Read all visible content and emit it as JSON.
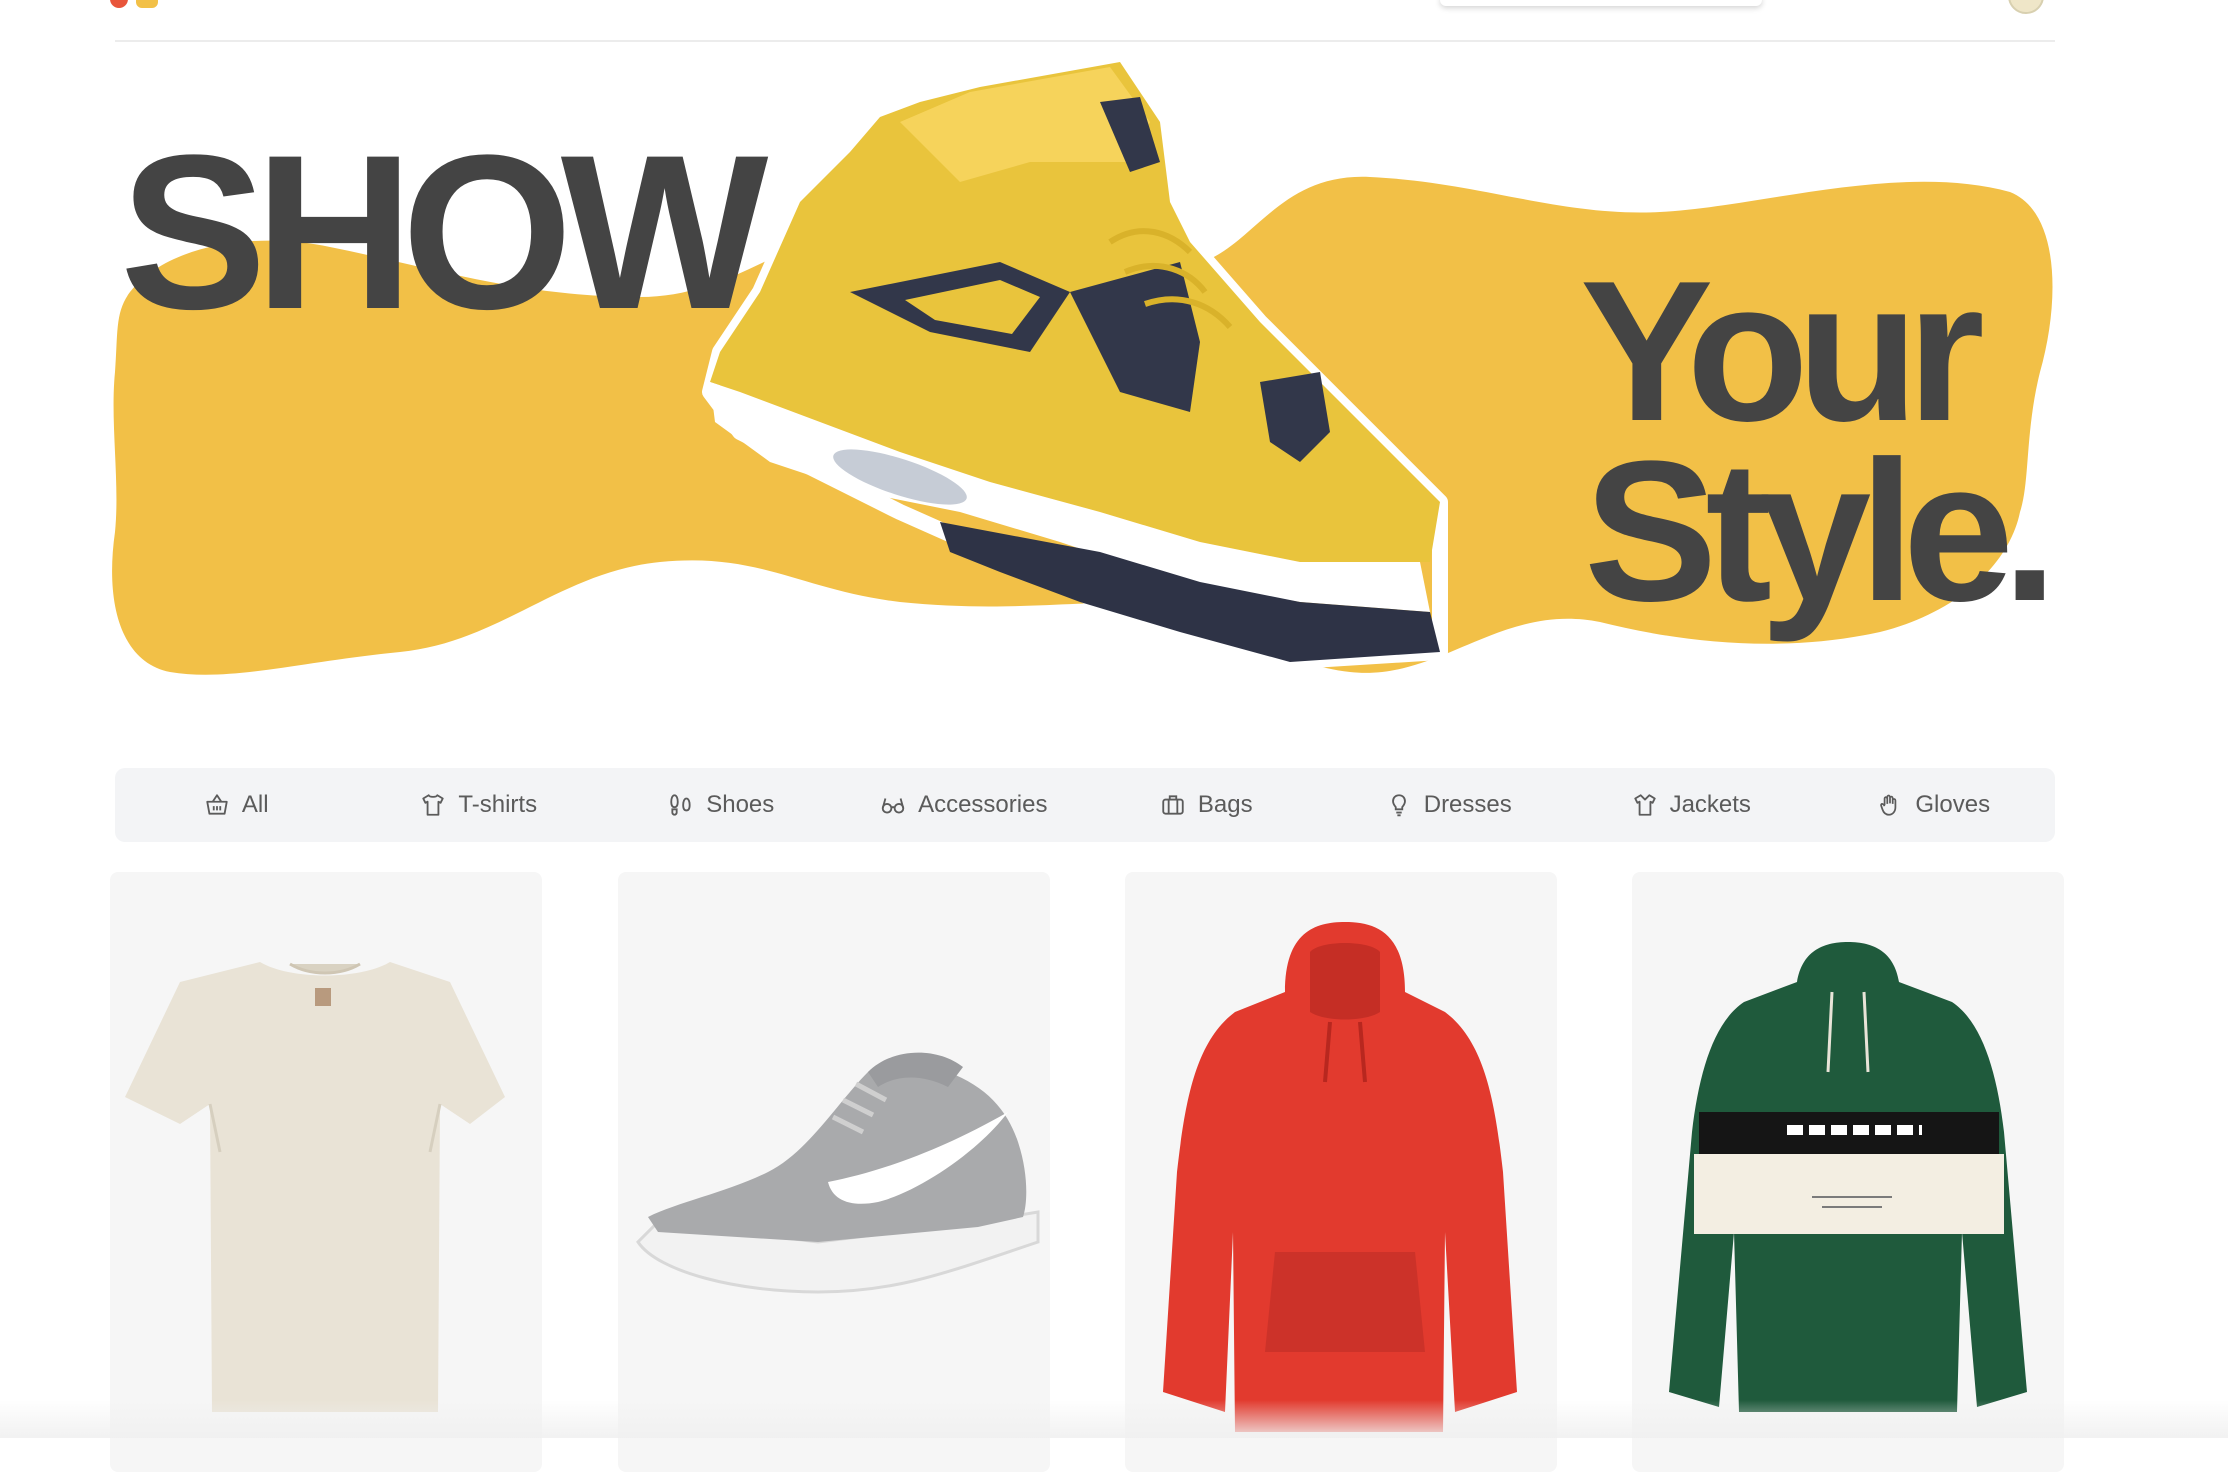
{
  "brand": {
    "colors": {
      "accent": "#f2c047",
      "text": "#444444",
      "logo_red": "#e8553b"
    }
  },
  "header": {
    "search_icon": "search-box",
    "avatar": "user-avatar"
  },
  "hero": {
    "line1": "SHOW",
    "line2": "Your",
    "line3": "Style.",
    "image": "yellow-sneaker"
  },
  "categories": [
    {
      "label": "All",
      "icon": "basket-icon"
    },
    {
      "label": "T-shirts",
      "icon": "tshirt-icon"
    },
    {
      "label": "Shoes",
      "icon": "footprints-icon"
    },
    {
      "label": "Accessories",
      "icon": "glasses-icon"
    },
    {
      "label": "Bags",
      "icon": "briefcase-icon"
    },
    {
      "label": "Dresses",
      "icon": "lightbulb-icon"
    },
    {
      "label": "Jackets",
      "icon": "shirt-icon"
    },
    {
      "label": "Gloves",
      "icon": "hand-icon"
    }
  ],
  "products": [
    {
      "image": "cream-oversized-tshirt"
    },
    {
      "image": "grey-running-sneaker"
    },
    {
      "image": "red-hoodie"
    },
    {
      "image": "green-colorblock-hoodie"
    }
  ]
}
